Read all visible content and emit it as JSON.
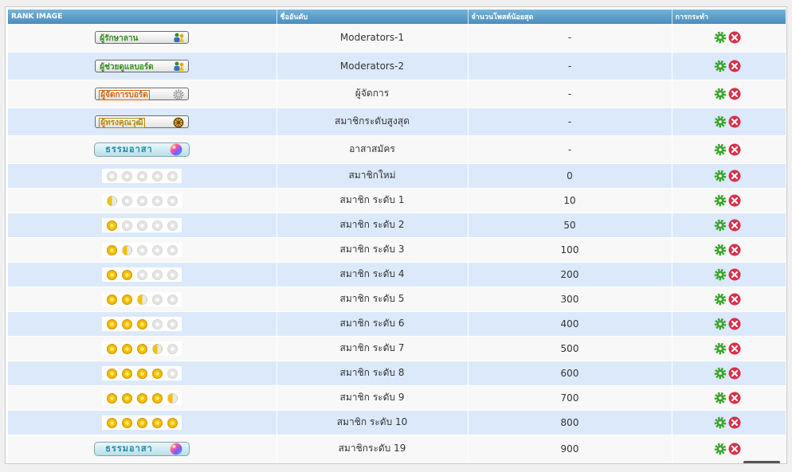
{
  "table": {
    "headers": {
      "rank_image": "RANK IMAGE",
      "rank_name": "ชื่ออันดับ",
      "min_posts": "จำนวนโพสต์น้อยสุด",
      "action": "การกระทำ"
    },
    "rows": [
      {
        "image": {
          "kind": "badge",
          "variant": "mod",
          "text": "ผู้รักษาลาน",
          "icon": "moderator-users-icon"
        },
        "name": "Moderators-1",
        "min_posts": "-"
      },
      {
        "image": {
          "kind": "badge",
          "variant": "mod",
          "text": "ผู้ช่วยดูแลบอร์ด",
          "icon": "moderator-users-icon"
        },
        "name": "Moderators-2",
        "min_posts": "-"
      },
      {
        "image": {
          "kind": "badge",
          "variant": "admin",
          "text": "ผู้จัดการบอร์ด",
          "icon": "gear-icon"
        },
        "name": "ผู้จัดการ",
        "min_posts": "-"
      },
      {
        "image": {
          "kind": "badge",
          "variant": "elder",
          "text": "ผู้ทรงคุณวุฒิ",
          "icon": "dharma-wheel-icon"
        },
        "name": "สมาชิกระดับสูงสุด",
        "min_posts": "-"
      },
      {
        "image": {
          "kind": "badge",
          "variant": "vol",
          "text": "ธรรมอาสา",
          "icon": "color-ball-icon"
        },
        "name": "อาสาสมัคร",
        "min_posts": "-"
      },
      {
        "image": {
          "kind": "wheels",
          "level": 0
        },
        "name": "สมาชิกใหม่",
        "min_posts": "0"
      },
      {
        "image": {
          "kind": "wheels",
          "level": 0.5
        },
        "name": "สมาชิก ระดับ 1",
        "min_posts": "10"
      },
      {
        "image": {
          "kind": "wheels",
          "level": 1
        },
        "name": "สมาชิก ระดับ 2",
        "min_posts": "50"
      },
      {
        "image": {
          "kind": "wheels",
          "level": 1.5
        },
        "name": "สมาชิก ระดับ 3",
        "min_posts": "100"
      },
      {
        "image": {
          "kind": "wheels",
          "level": 2
        },
        "name": "สมาชิก ระดับ 4",
        "min_posts": "200"
      },
      {
        "image": {
          "kind": "wheels",
          "level": 2.5
        },
        "name": "สมาชิก ระดับ 5",
        "min_posts": "300"
      },
      {
        "image": {
          "kind": "wheels",
          "level": 3
        },
        "name": "สมาชิก ระดับ 6",
        "min_posts": "400"
      },
      {
        "image": {
          "kind": "wheels",
          "level": 3.5
        },
        "name": "สมาชิก ระดับ 7",
        "min_posts": "500"
      },
      {
        "image": {
          "kind": "wheels",
          "level": 4
        },
        "name": "สมาชิก ระดับ 8",
        "min_posts": "600"
      },
      {
        "image": {
          "kind": "wheels",
          "level": 4.5
        },
        "name": "สมาชิก ระดับ 9",
        "min_posts": "700"
      },
      {
        "image": {
          "kind": "wheels",
          "level": 5
        },
        "name": "สมาชิก ระดับ 10",
        "min_posts": "800"
      },
      {
        "image": {
          "kind": "badge",
          "variant": "vol",
          "text": "ธรรมอาสา",
          "icon": "color-ball-icon"
        },
        "name": "สมาชิกระดับ 19",
        "min_posts": "900"
      }
    ],
    "actions": {
      "edit_icon": "gear-icon",
      "delete_icon": "delete-icon",
      "edit_color": "#3aa52c",
      "delete_color": "#d9304a"
    }
  }
}
